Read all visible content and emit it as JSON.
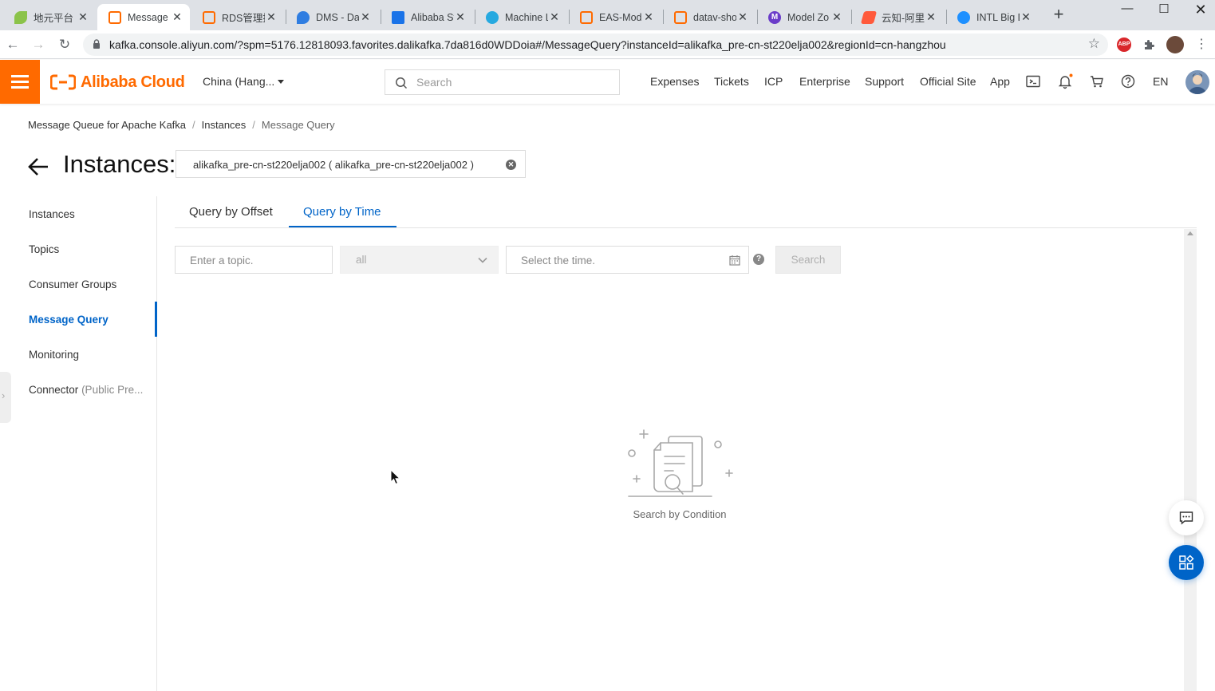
{
  "browser": {
    "tabs": [
      {
        "title": "地元平台",
        "icon": "leaf-icon",
        "active": false
      },
      {
        "title": "Message Q",
        "icon": "aliyun-icon",
        "active": true
      },
      {
        "title": "RDS管理控",
        "icon": "aliyun-icon",
        "active": false
      },
      {
        "title": "DMS - Da",
        "icon": "dms-icon",
        "active": false
      },
      {
        "title": "Alibaba St",
        "icon": "alibaba-stream-icon",
        "active": false
      },
      {
        "title": "Machine L",
        "icon": "machine-learning-icon",
        "active": false
      },
      {
        "title": "EAS-Mode",
        "icon": "aliyun-icon",
        "active": false
      },
      {
        "title": "datav-sho",
        "icon": "aliyun-icon",
        "active": false
      },
      {
        "title": "Model Zo",
        "icon": "m-icon",
        "active": false
      },
      {
        "title": "云知-阿里",
        "icon": "yunzhi-icon",
        "active": false
      },
      {
        "title": "INTL Big D",
        "icon": "intl-icon",
        "active": false
      }
    ],
    "url": "kafka.console.aliyun.com/?spm=5176.12818093.favorites.dalikafka.7da816d0WDDoia#/MessageQuery?instanceId=alikafka_pre-cn-st220elja002&regionId=cn-hangzhou",
    "extension_abp": "ABP"
  },
  "topnav": {
    "logo_text": "Alibaba Cloud",
    "region": "China (Hang...",
    "search_placeholder": "Search",
    "links": [
      "Expenses",
      "Tickets",
      "ICP",
      "Enterprise",
      "Support",
      "Official Site",
      "App"
    ],
    "language": "EN"
  },
  "breadcrumb": {
    "items": [
      "Message Queue for Apache Kafka",
      "Instances",
      "Message Query"
    ]
  },
  "header": {
    "title": "Instances:",
    "instance_value": "alikafka_pre-cn-st220elja002 ( alikafka_pre-cn-st220elja002 )"
  },
  "sidebar": {
    "items": [
      {
        "label": "Instances",
        "active": false
      },
      {
        "label": "Topics",
        "active": false
      },
      {
        "label": "Consumer Groups",
        "active": false
      },
      {
        "label": "Message Query",
        "active": true
      },
      {
        "label": "Monitoring",
        "active": false
      },
      {
        "label": "Connector",
        "suffix": "(Public Pre...",
        "active": false
      }
    ]
  },
  "query_tabs": [
    {
      "label": "Query by Offset",
      "active": false
    },
    {
      "label": "Query by Time",
      "active": true
    }
  ],
  "filters": {
    "topic_placeholder": "Enter a topic.",
    "partition_value": "all",
    "time_placeholder": "Select the time.",
    "help": "?",
    "search_label": "Search"
  },
  "empty_state": {
    "text": "Search by Condition"
  },
  "colors": {
    "brand_orange": "#ff6a00",
    "accent_blue": "#0064c8"
  }
}
